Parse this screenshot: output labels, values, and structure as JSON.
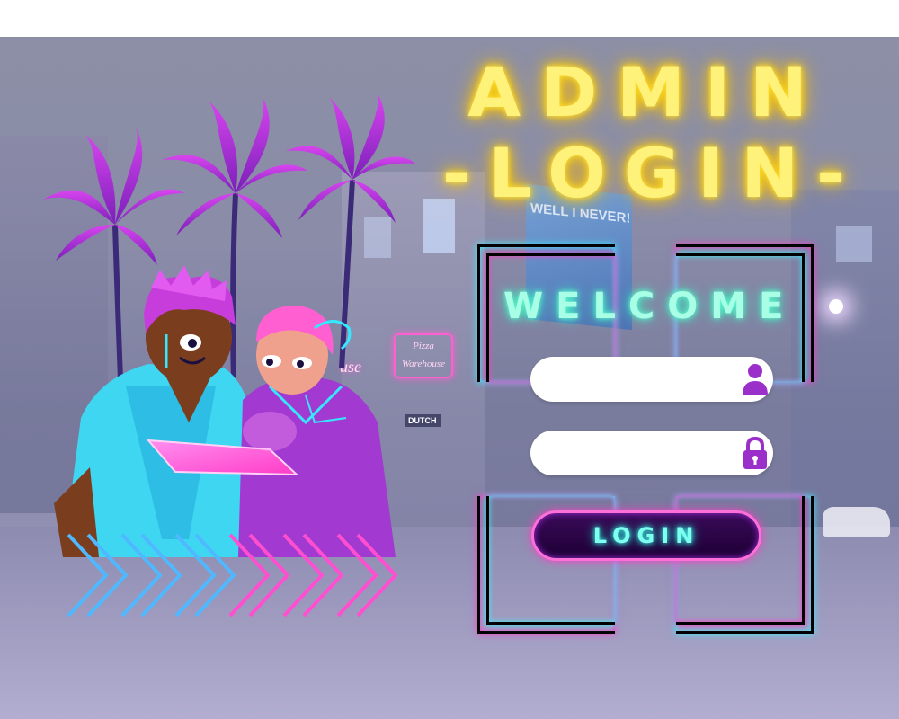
{
  "title": {
    "line1": "ADMIN",
    "line2": "-LOGIN-"
  },
  "scene": {
    "billboard_text": "WELL I NEVER!",
    "neon_sign_1": "Pizza Warehouse",
    "neon_sign_2": "use",
    "shop_sign": "DUTCH"
  },
  "form": {
    "welcome": "WELCOME",
    "username": {
      "value": "",
      "placeholder": ""
    },
    "password": {
      "value": "",
      "placeholder": ""
    },
    "login_label": "LOGIN"
  },
  "icons": {
    "username": "user-icon",
    "password": "lock-icon"
  },
  "colors": {
    "title": "#fff27a",
    "welcome": "#a8ffe6",
    "bracket_cyan": "#3df2ff",
    "bracket_pink": "#ff3cc7",
    "button_bg": "#2a0645",
    "button_text": "#7ffff0"
  }
}
